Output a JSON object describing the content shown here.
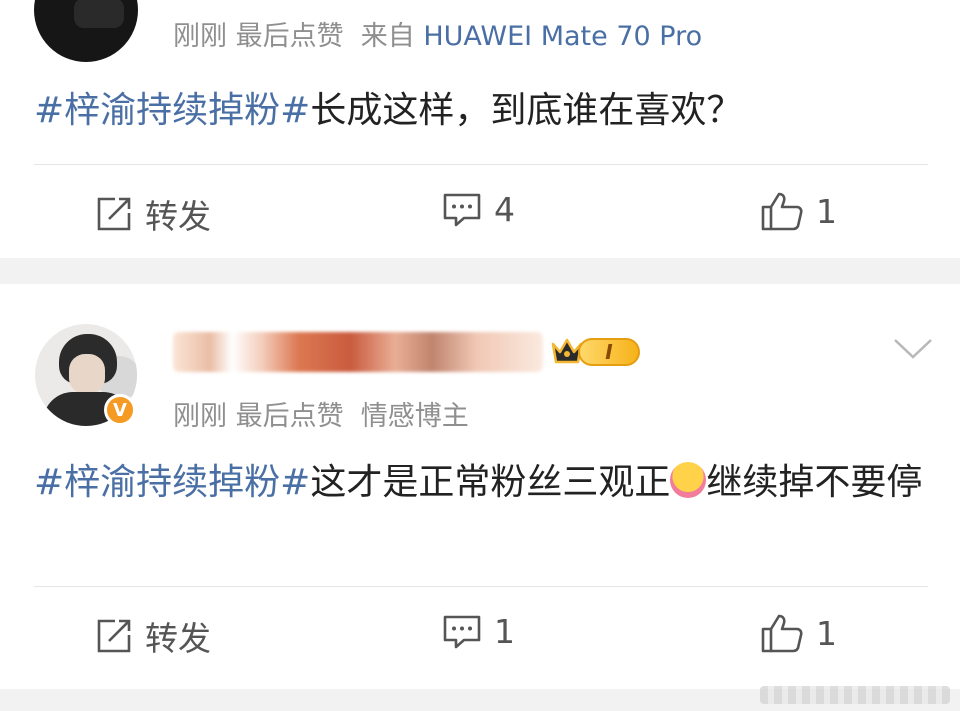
{
  "post1": {
    "meta_time": "刚刚",
    "meta_action": "最后点赞",
    "meta_from": "来自",
    "meta_device": "HUAWEI Mate 70 Pro",
    "hashtag": "#梓渝持续掉粉#",
    "text": "长成这样，到底谁在喜欢？",
    "repost_label": "转发",
    "comment_count": "4",
    "like_count": "1"
  },
  "post2": {
    "rank_label": "I",
    "meta_time": "刚刚",
    "meta_action": "最后点赞",
    "meta_role": "情感博主",
    "hashtag": "#梓渝持续掉粉#",
    "text_part1": "这才是正常粉丝三观正",
    "text_part2": "继续掉不要停",
    "repost_label": "转发",
    "comment_count": "1",
    "like_count": "1"
  },
  "colors": {
    "hashtag": "#4a6fa5",
    "meta": "#8f8f8f",
    "verified": "#f59a23",
    "background": "#f2f2f2"
  },
  "icons": [
    "repost-icon",
    "comment-icon",
    "like-icon",
    "crown-icon",
    "chevron-down-icon",
    "verified-icon"
  ]
}
